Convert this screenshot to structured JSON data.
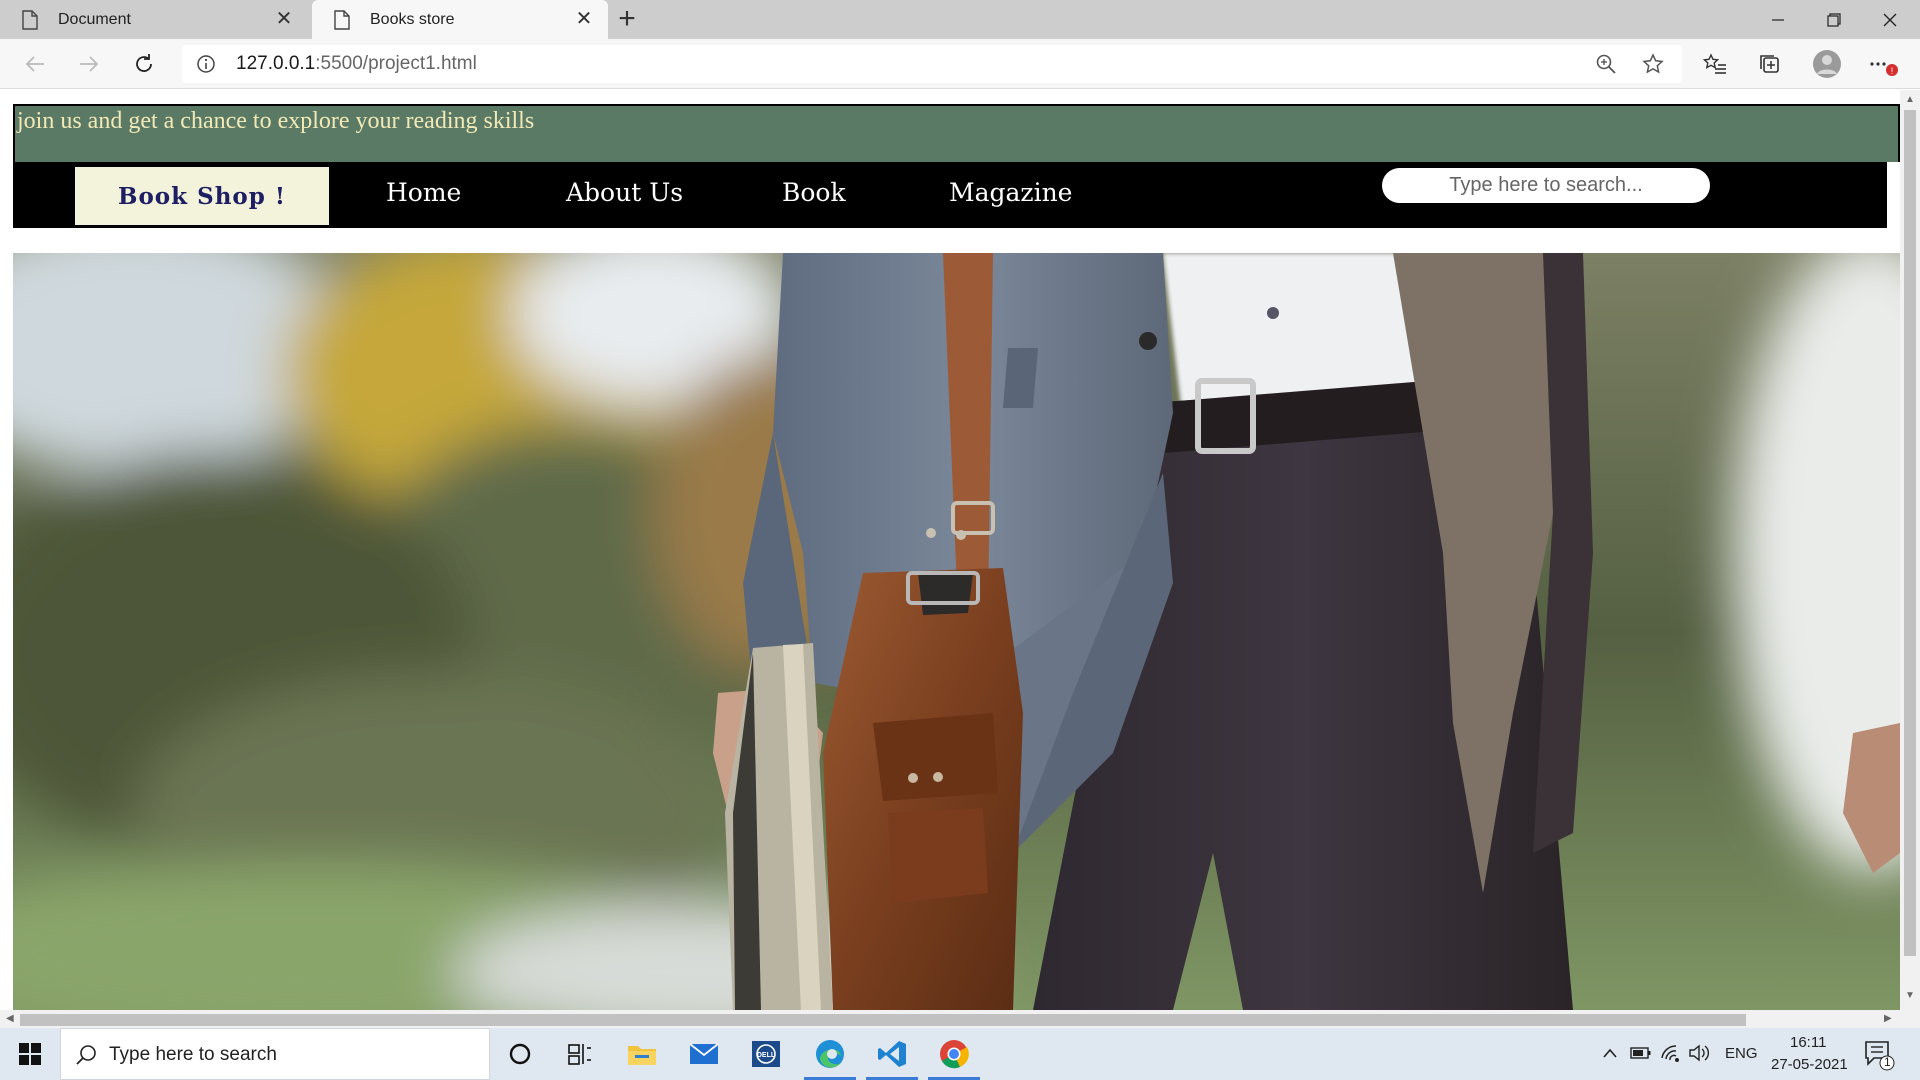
{
  "browser": {
    "tabs": [
      {
        "title": "Document",
        "active": false
      },
      {
        "title": "Books store",
        "active": true
      }
    ],
    "address": {
      "host": "127.0.0.1",
      "path": ":5500/project1.html"
    }
  },
  "page": {
    "banner_text": "join us and get a chance to explore your reading skills",
    "brand": "Book Shop !",
    "nav": [
      {
        "label": "Home"
      },
      {
        "label": "About Us"
      },
      {
        "label": "Book"
      },
      {
        "label": "Magazine"
      }
    ],
    "search": {
      "placeholder": "Type here to search..."
    }
  },
  "taskbar": {
    "search_placeholder": "Type here to search",
    "language": "ENG",
    "time": "16:11",
    "date": "27-05-2021",
    "notification_count": "1"
  },
  "colors": {
    "banner_bg": "#5a7a66",
    "banner_text": "#f2e9b6",
    "navbar_bg": "#000000",
    "brand_bg": "#f3f3dc",
    "brand_text": "#1e1e63"
  },
  "icons": [
    "document-icon",
    "close-icon",
    "new-tab-icon",
    "back-icon",
    "forward-icon",
    "refresh-icon",
    "info-icon",
    "zoom-icon",
    "star-icon",
    "favorites-icon",
    "collections-icon",
    "profile-icon",
    "more-icon",
    "windows-start-icon",
    "search-icon",
    "cortana-icon",
    "task-view-icon",
    "file-explorer-icon",
    "mail-icon",
    "dell-icon",
    "edge-icon",
    "vscode-icon",
    "chrome-icon",
    "chevron-up-icon",
    "battery-icon",
    "wifi-icon",
    "volume-icon",
    "notifications-icon"
  ]
}
